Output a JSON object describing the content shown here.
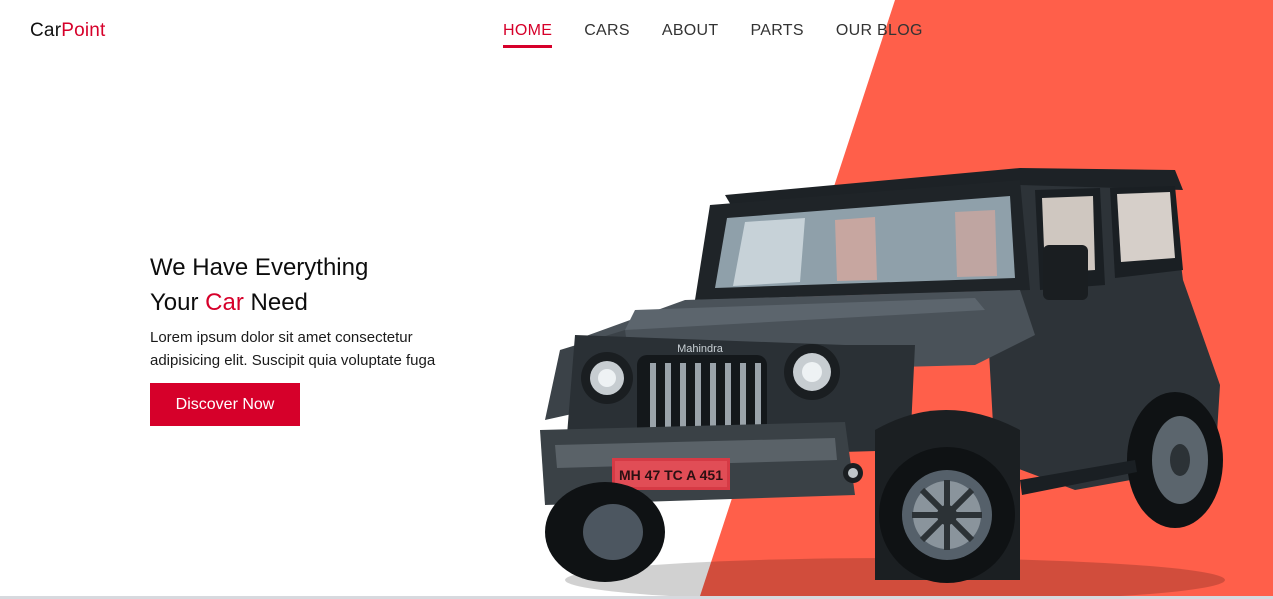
{
  "brand": {
    "name_part1": "Car",
    "name_part2": "Point"
  },
  "nav": {
    "items": [
      {
        "label": "HOME",
        "active": true
      },
      {
        "label": "CARS",
        "active": false
      },
      {
        "label": "ABOUT",
        "active": false
      },
      {
        "label": "PARTS",
        "active": false
      },
      {
        "label": "OUR BLOG",
        "active": false
      }
    ]
  },
  "hero": {
    "headline_line1": "We Have Everything",
    "headline_line2_pre": "Your ",
    "headline_line2_accent": "Car",
    "headline_line2_post": " Need",
    "description_line1": "Lorem ipsum dolor sit amet consectetur",
    "description_line2": "adipisicing elit. Suscipit quia voluptate fuga",
    "cta_label": "Discover Now",
    "image_icon": "suv-jeep-image",
    "license_plate": "MH 47 TC A 451",
    "grille_badge": "Mahindra"
  },
  "colors": {
    "accent": "#d6002a",
    "hero_shape": "#ff5f4a",
    "background": "#ffffff"
  }
}
